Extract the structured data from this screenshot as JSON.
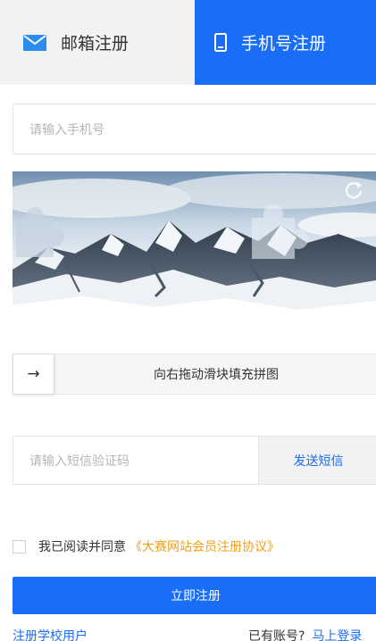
{
  "tabs": {
    "email": {
      "label": "邮箱注册",
      "icon": "envelope-icon"
    },
    "phone": {
      "label": "手机号注册",
      "icon": "mobile-phone-icon",
      "active": true
    }
  },
  "phone_input": {
    "placeholder": "请输入手机号",
    "value": ""
  },
  "captcha": {
    "refresh_icon": "refresh-icon",
    "slider_handle_icon": "→",
    "slider_hint": "向右拖动滑块填充拼图"
  },
  "sms": {
    "placeholder": "请输入短信验证码",
    "value": "",
    "send_label": "发送短信"
  },
  "agreement": {
    "checked": false,
    "text": "我已阅读并同意",
    "link": "《大赛网站会员注册协议》"
  },
  "submit_label": "立即注册",
  "footer": {
    "school_register": "注册学校用户",
    "has_account": "已有账号?",
    "login": "马上登录"
  },
  "colors": {
    "primary": "#1a6df5",
    "link_orange": "#f0a01a",
    "inactive_tab": "#f2f2f2"
  }
}
